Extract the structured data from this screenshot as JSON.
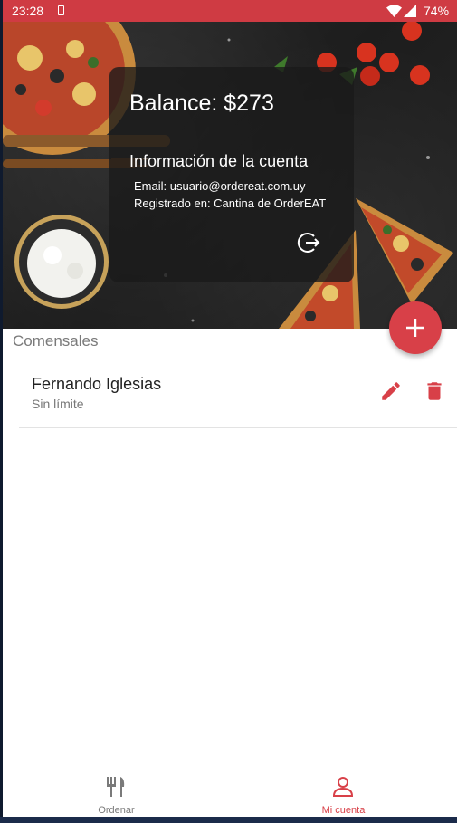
{
  "status_bar": {
    "time": "23:28",
    "battery": "74%",
    "icons": [
      "sim-card-icon",
      "wifi-icon",
      "signal-icon"
    ]
  },
  "account": {
    "balance_label": "Balance: $273",
    "info_title": "Información de la cuenta",
    "email": "Email: usuario@ordereat.com.uy",
    "registered": "Registrado en: Cantina de OrderEAT",
    "logout_icon": "logout-icon"
  },
  "fab": {
    "icon": "plus-icon"
  },
  "diners": {
    "section_title": "Comensales",
    "items": [
      {
        "name": "Fernando Iglesias",
        "limit": "Sin límite"
      }
    ],
    "actions": [
      "edit-icon",
      "delete-icon"
    ]
  },
  "bottom_nav": {
    "items": [
      {
        "label": "Ordenar",
        "icon": "fork-knife-icon",
        "active": false
      },
      {
        "label": "Mi cuenta",
        "icon": "person-icon",
        "active": true
      }
    ]
  },
  "colors": {
    "accent": "#d84048",
    "status_bar": "#cf3b43",
    "muted_text": "#7a7a7a"
  }
}
